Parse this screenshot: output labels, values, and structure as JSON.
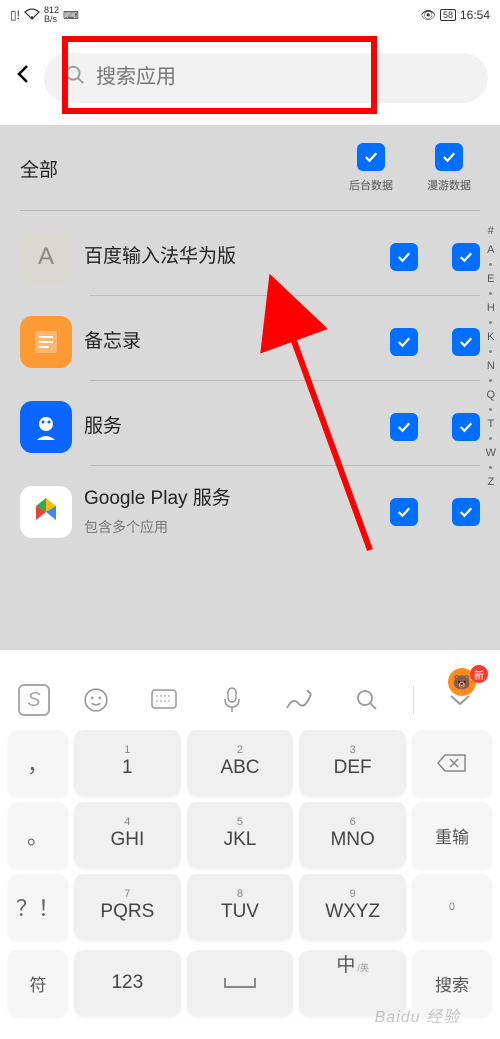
{
  "status": {
    "speed_num": "812",
    "speed_unit": "B/s",
    "time": "16:54",
    "battery": "58"
  },
  "search": {
    "placeholder": "搜索应用"
  },
  "columns": {
    "all": "全部",
    "bg": "后台数据",
    "roam": "漫游数据"
  },
  "apps": [
    {
      "name": "百度输入法华为版",
      "sub": "",
      "bg": true,
      "roam": true,
      "icon_letter": "A",
      "icon_bg": "#d9d9d2",
      "icon_fg": "#888"
    },
    {
      "name": "备忘录",
      "sub": "",
      "bg": true,
      "roam": true,
      "icon_letter": "",
      "icon_bg": "#ff9933",
      "icon_fg": "#fff"
    },
    {
      "name": "服务",
      "sub": "",
      "bg": true,
      "roam": true,
      "icon_letter": "",
      "icon_bg": "#0a66ff",
      "icon_fg": "#fff"
    },
    {
      "name": "Google Play 服务",
      "sub": "包含多个应用",
      "bg": true,
      "roam": true,
      "icon_letter": "",
      "icon_bg": "#fff",
      "icon_fg": ""
    }
  ],
  "index_letters": [
    "#",
    "A",
    "",
    "E",
    "",
    "H",
    "",
    "K",
    "",
    "N",
    "",
    "Q",
    "",
    "T",
    "",
    "W",
    "",
    "Z"
  ],
  "keyboard": {
    "toolbar": [
      "sogou-logo",
      "emoji",
      "keyboard",
      "mic",
      "handwrite",
      "search",
      "collapse"
    ],
    "side_left": [
      "，",
      "。",
      "？！"
    ],
    "rows": [
      [
        {
          "n": "1",
          "m": "1"
        },
        {
          "n": "2",
          "m": "ABC"
        },
        {
          "n": "3",
          "m": "DEF"
        }
      ],
      [
        {
          "n": "4",
          "m": "GHI"
        },
        {
          "n": "5",
          "m": "JKL"
        },
        {
          "n": "6",
          "m": "MNO"
        }
      ],
      [
        {
          "n": "7",
          "m": "PQRS"
        },
        {
          "n": "8",
          "m": "TUV"
        },
        {
          "n": "9",
          "m": "WXYZ"
        }
      ]
    ],
    "side_right": [
      "⌫",
      "重输",
      ""
    ],
    "bottom": {
      "sym": "符",
      "num": "123",
      "space": "␣",
      "lang_main": "中",
      "lang_sub": "/英",
      "enter": "搜索"
    },
    "ime_new": "新"
  },
  "watermark": "Baidu 经验"
}
